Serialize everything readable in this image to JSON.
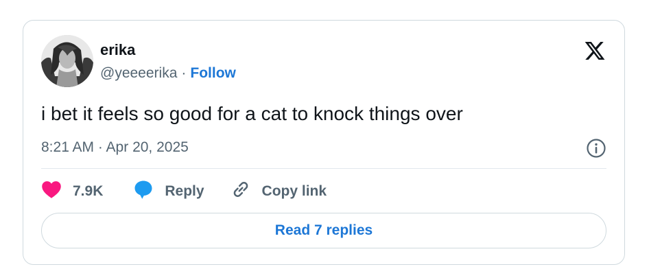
{
  "author": {
    "name": "erika",
    "handle": "@yeeeerika",
    "separator": "·",
    "follow_label": "Follow"
  },
  "tweet": {
    "text": "i bet it feels so good for a cat to knock things over",
    "timestamp": "8:21 AM · Apr 20, 2025"
  },
  "actions": {
    "like_count": "7.9K",
    "reply_label": "Reply",
    "copy_link_label": "Copy link"
  },
  "read_replies_label": "Read 7 replies",
  "icons": {
    "brand": "x-logo-icon",
    "info": "info-icon",
    "like": "heart-icon",
    "reply": "speech-bubble-icon",
    "copy": "link-icon"
  },
  "colors": {
    "heart": "#f91880",
    "reply_bubble": "#1d9bf0",
    "link_blue": "#1d77d6",
    "secondary_text": "#536471",
    "border": "#cfd9de"
  }
}
